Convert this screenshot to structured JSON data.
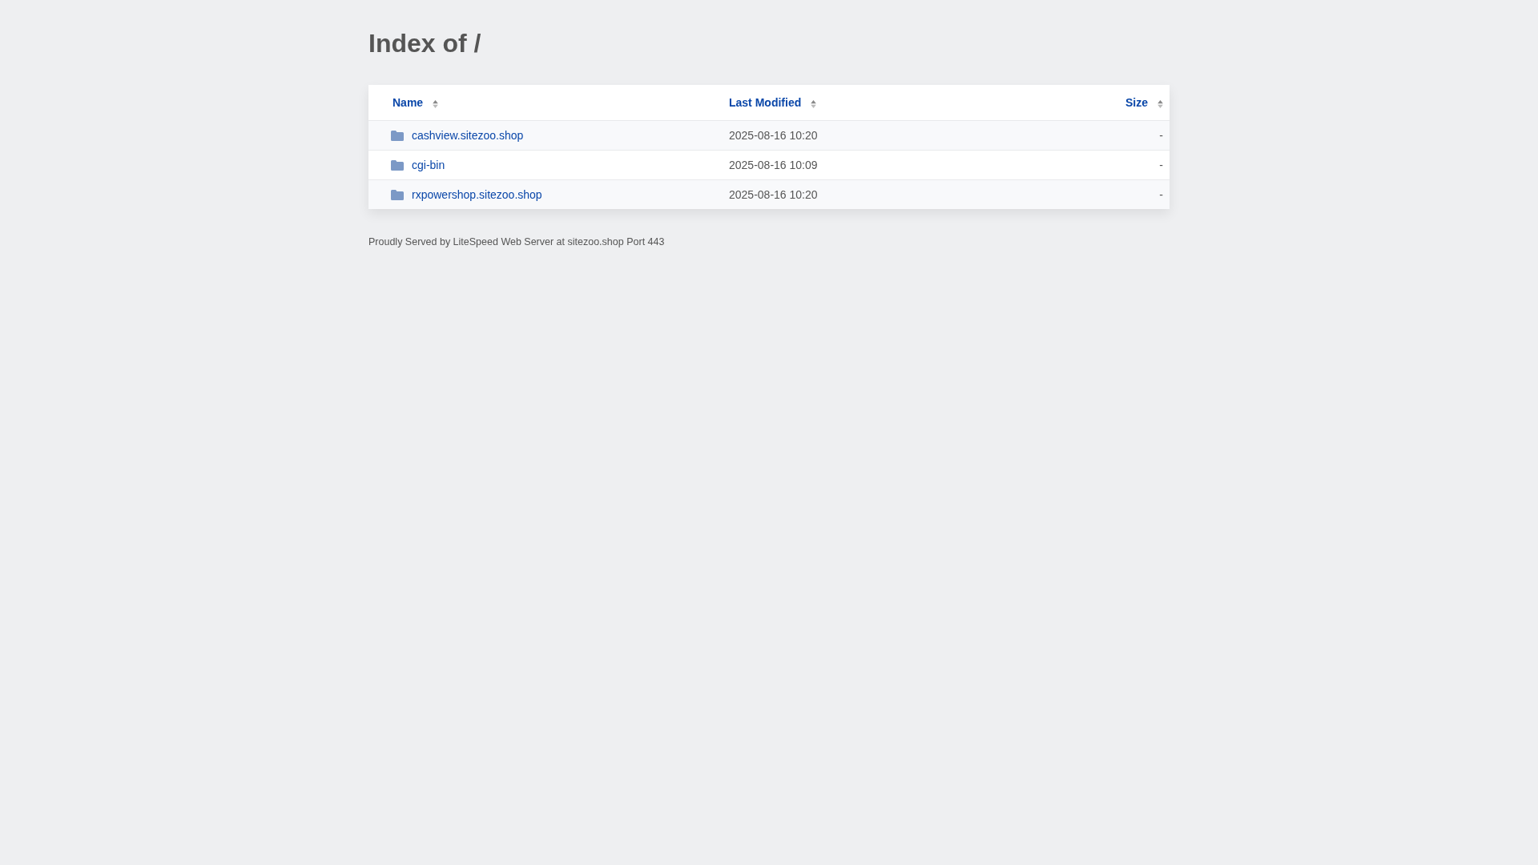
{
  "title": "Index of /",
  "table": {
    "columns": [
      "Name",
      "Last Modified",
      "Size"
    ],
    "rows": [
      {
        "kind": "folder",
        "name": "cashview.sitezoo.shop",
        "modified": "2025-08-16 10:20",
        "size": "-"
      },
      {
        "kind": "folder",
        "name": "cgi-bin",
        "modified": "2025-08-16 10:09",
        "size": "-"
      },
      {
        "kind": "folder",
        "name": "rxpowershop.sitezoo.shop",
        "modified": "2025-08-16 10:20",
        "size": "-"
      }
    ]
  },
  "footer": "Proudly Served by LiteSpeed Web Server at sitezoo.shop Port 443"
}
